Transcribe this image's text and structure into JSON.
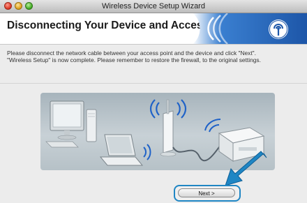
{
  "window": {
    "title": "Wireless Device Setup Wizard"
  },
  "header": {
    "title": "Disconnecting Your Device and Access Point"
  },
  "message": {
    "line1": "Please disconnect the network cable between your access point and the device and click \"Next\".",
    "line2": "\"Wireless Setup\" is now complete. Please remember to restore the firewall, to the original settings."
  },
  "buttons": {
    "next_label": "Next >"
  },
  "icons": {
    "window_controls": [
      "close-icon",
      "minimize-icon",
      "zoom-icon"
    ],
    "banner": "wireless-signal-icon",
    "callout": "arrow-pointer-icon"
  },
  "colors": {
    "accent_blue": "#1f86c4",
    "banner_blue": "#2a6fc4"
  }
}
